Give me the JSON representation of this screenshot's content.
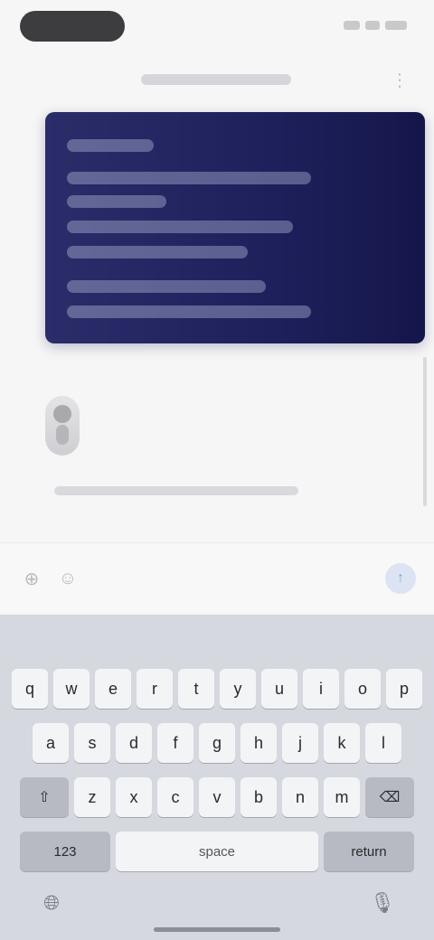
{
  "status_bar": {
    "time": ""
  },
  "header": {
    "title": ""
  },
  "message_card": {
    "lines": [
      "",
      "",
      "",
      "",
      "",
      ""
    ]
  },
  "reply": {
    "caption": ""
  },
  "input": {
    "placeholder": "",
    "value": ""
  },
  "keyboard": {
    "suggestions": [
      "",
      "",
      ""
    ],
    "row1": [
      "q",
      "w",
      "e",
      "r",
      "t",
      "y",
      "u",
      "i",
      "o",
      "p"
    ],
    "row2": [
      "a",
      "s",
      "d",
      "f",
      "g",
      "h",
      "j",
      "k",
      "l"
    ],
    "row3": [
      "z",
      "x",
      "c",
      "v",
      "b",
      "n",
      "m"
    ],
    "shift_label": "⇧",
    "delete_label": "⌫",
    "numbers_label": "123",
    "space_label": "space",
    "return_label": "return"
  },
  "colors": {
    "card_bg": "#1e205c",
    "keyboard_bg": "#d5d8de",
    "send_accent": "#8ea2cf"
  },
  "icons": {
    "attach": "plus-icon",
    "emoji": "emoji-icon",
    "send": "arrow-up-icon",
    "globe": "globe-icon",
    "mic": "microphone-icon"
  }
}
